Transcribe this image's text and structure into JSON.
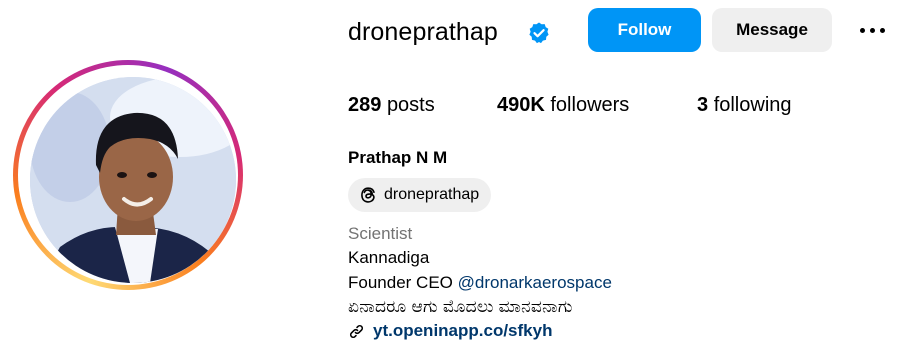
{
  "profile": {
    "username": "droneprathap",
    "verified": true,
    "full_name": "Prathap N M",
    "avatar_alt": "profile photo"
  },
  "actions": {
    "follow_label": "Follow",
    "message_label": "Message",
    "more_icon": "more-options-icon"
  },
  "stats": {
    "posts_count": "289",
    "posts_label": "posts",
    "followers_count": "490K",
    "followers_label": "followers",
    "following_count": "3",
    "following_label": "following"
  },
  "threads": {
    "handle": "droneprathap",
    "icon": "threads-icon"
  },
  "bio": {
    "category": "Scientist",
    "line1": "Kannadiga",
    "line2_prefix": "Founder CEO",
    "line2_mention": "@dronarkaerospace",
    "line3": "ಏನಾದರೂ ಆಗು ಮೊದಲು ಮಾನವನಾಗು",
    "link_icon": "link-icon",
    "link": "yt.openinapp.co/sfkyh"
  },
  "colors": {
    "follow_button": "#0095f6",
    "secondary_button": "#efefef",
    "verified_badge": "#0095f6",
    "category_text": "#737373",
    "link_text": "#00376b"
  }
}
